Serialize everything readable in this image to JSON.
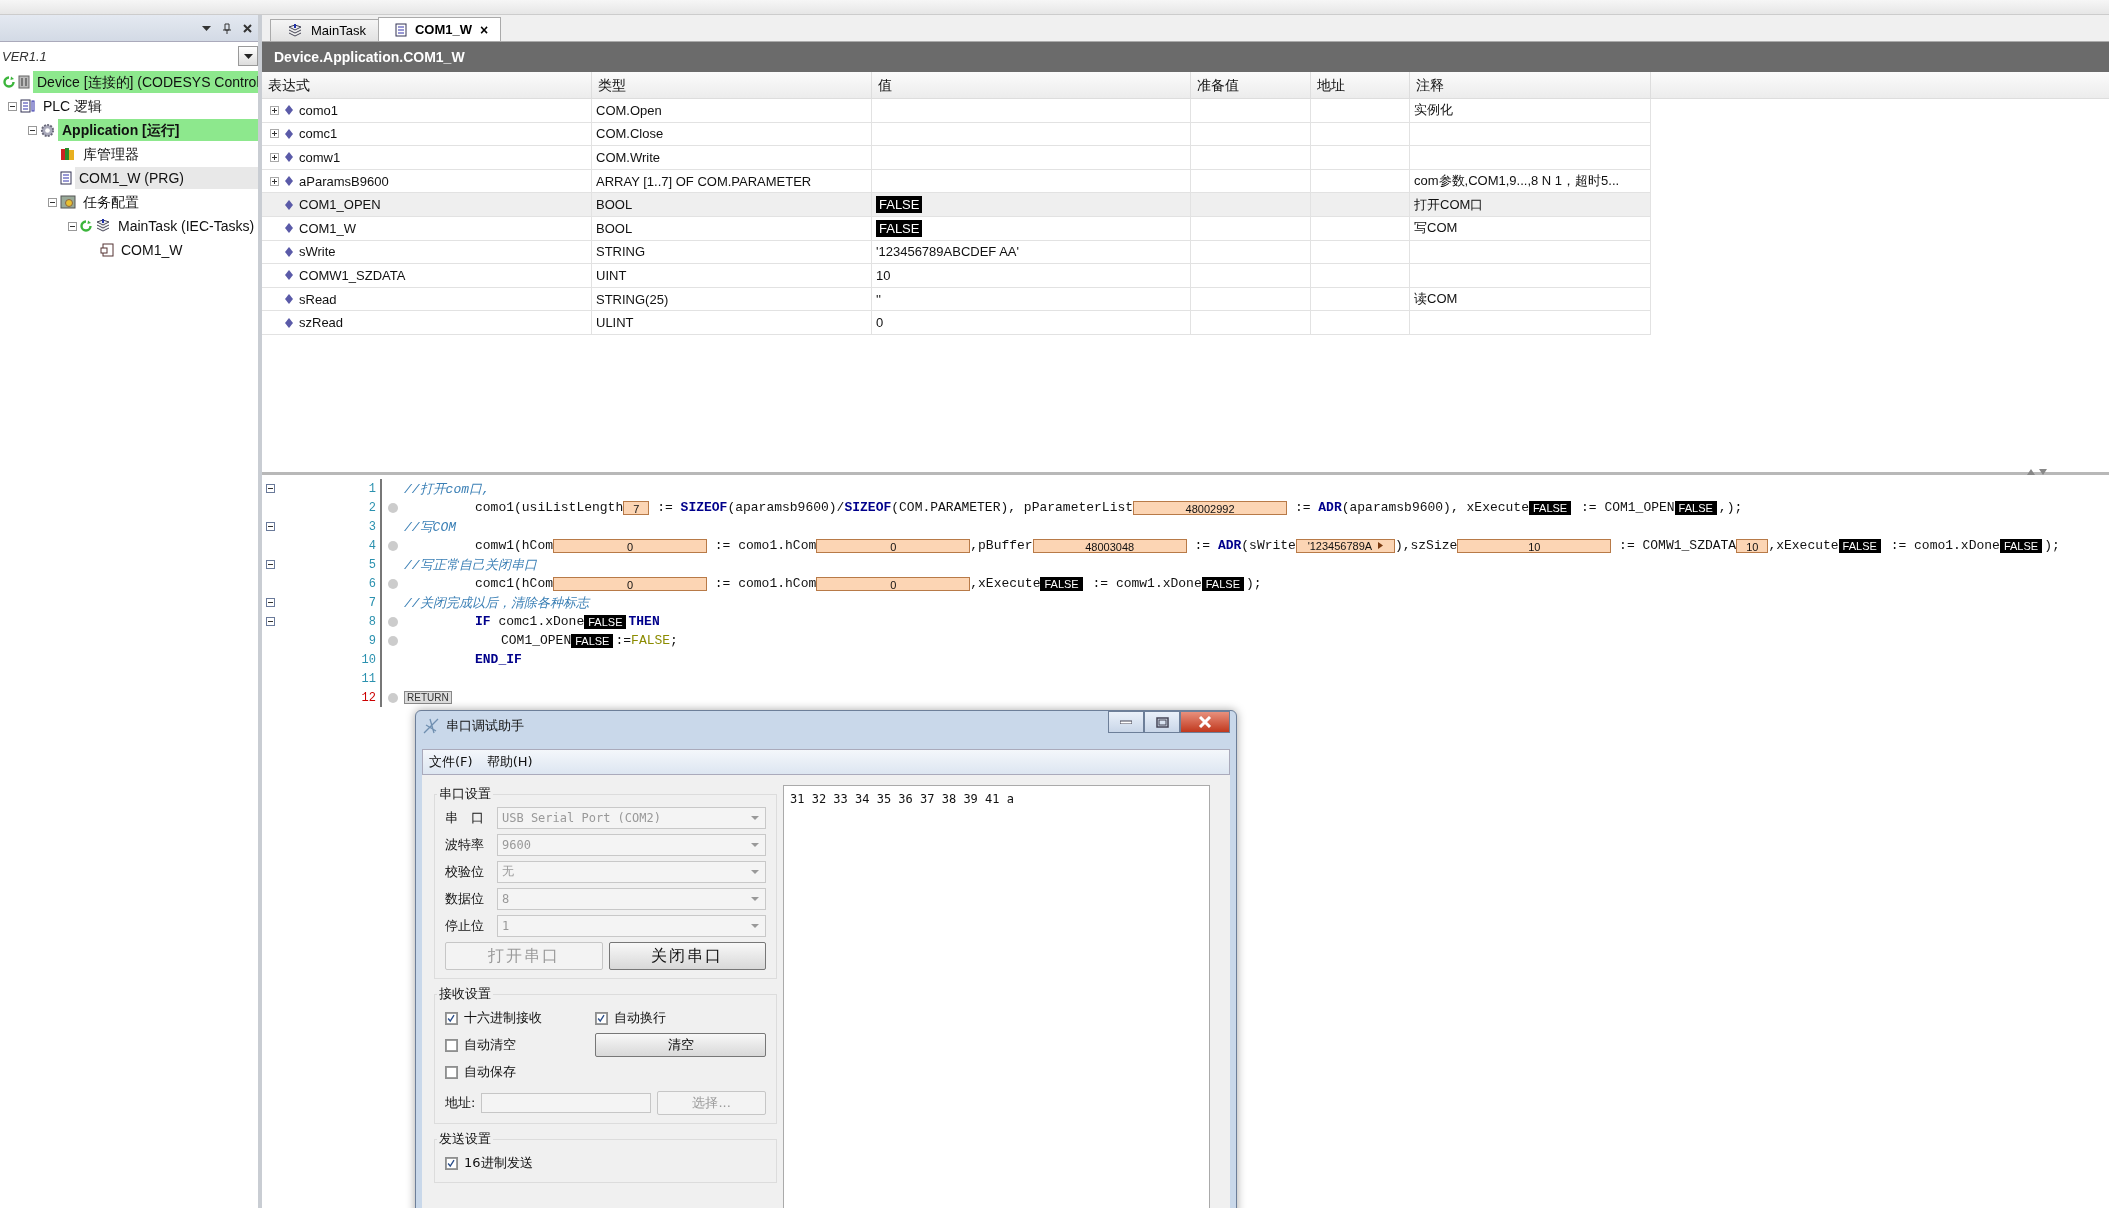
{
  "left_panel": {
    "version": "VER1.1",
    "tree": [
      {
        "label": "Device [连接的] (CODESYS Control",
        "kind": "device",
        "running": true,
        "highlighted": true,
        "selected": false,
        "active": false,
        "children": [
          {
            "label": "PLC 逻辑",
            "kind": "plc",
            "running": false,
            "highlighted": false,
            "selected": false,
            "active": false,
            "children": [
              {
                "label": "Application [运行]",
                "kind": "application",
                "running": false,
                "highlighted": true,
                "selected": false,
                "active": true,
                "children": [
                  {
                    "label": "库管理器",
                    "kind": "library",
                    "running": false,
                    "highlighted": false,
                    "selected": false,
                    "active": false
                  },
                  {
                    "label": "COM1_W (PRG)",
                    "kind": "pou",
                    "running": false,
                    "highlighted": false,
                    "selected": true,
                    "active": false
                  },
                  {
                    "label": "任务配置",
                    "kind": "taskconfig",
                    "running": false,
                    "highlighted": false,
                    "selected": false,
                    "active": false,
                    "children": [
                      {
                        "label": "MainTask (IEC-Tasks)",
                        "kind": "task",
                        "running": true,
                        "highlighted": false,
                        "selected": false,
                        "active": false,
                        "children": [
                          {
                            "label": "COM1_W",
                            "kind": "program",
                            "running": false,
                            "highlighted": false,
                            "selected": false,
                            "active": false
                          }
                        ]
                      }
                    ]
                  }
                ]
              }
            ]
          }
        ]
      }
    ]
  },
  "tabs": [
    {
      "label": "MainTask",
      "kind": "task",
      "selected": false
    },
    {
      "label": "COM1_W",
      "kind": "pou",
      "selected": true,
      "close": "×"
    }
  ],
  "editor_title": "Device.Application.COM1_W",
  "table": {
    "columns": [
      "表达式",
      "类型",
      "值",
      "准备值",
      "地址",
      "注释"
    ],
    "rows": [
      {
        "expression": "como1",
        "type": "COM.Open",
        "expandable": true,
        "selected": false,
        "kind": "plain",
        "comment": "实例化"
      },
      {
        "expression": "comc1",
        "type": "COM.Close",
        "expandable": true,
        "selected": false,
        "kind": "plain"
      },
      {
        "expression": "comw1",
        "type": "COM.Write",
        "expandable": true,
        "selected": false,
        "kind": "plain"
      },
      {
        "expression": "aParamsB9600",
        "type": "ARRAY [1..7] OF COM.PARAMETER",
        "expandable": true,
        "selected": false,
        "kind": "plain",
        "comment": "com参数,COM1,9...,8 N 1，超时5..."
      },
      {
        "expression": "COM1_OPEN",
        "type": "BOOL",
        "value": "FALSE",
        "expandable": false,
        "selected": true,
        "kind": "bool",
        "comment": "打开COM口"
      },
      {
        "expression": "COM1_W",
        "type": "BOOL",
        "value": "FALSE",
        "expandable": false,
        "selected": false,
        "kind": "bool",
        "comment": "写COM"
      },
      {
        "expression": "sWrite",
        "type": "STRING",
        "value": "'123456789ABCDEF AA'",
        "expandable": false,
        "selected": false,
        "kind": "plain"
      },
      {
        "expression": "COMW1_SZDATA",
        "type": "UINT",
        "value": "10",
        "expandable": false,
        "selected": false,
        "kind": "plain"
      },
      {
        "expression": "sRead",
        "type": "STRING(25)",
        "value": "''",
        "expandable": false,
        "selected": false,
        "kind": "plain",
        "comment": "读COM"
      },
      {
        "expression": "szRead",
        "type": "ULINT",
        "value": "0",
        "expandable": false,
        "selected": false,
        "kind": "plain"
      }
    ]
  },
  "code": [
    {
      "number": "1",
      "kind": "comment",
      "fold": true,
      "breakpoint": false,
      "current": false,
      "segments": [
        {
          "kind": "comment",
          "text": "//打开com口,"
        }
      ]
    },
    {
      "number": "2",
      "kind": "code",
      "fold": false,
      "breakpoint": true,
      "current": false,
      "segments": [
        {
          "kind": "text",
          "text": "como1(usiListLength"
        },
        {
          "kind": "value_small",
          "text": "7"
        },
        {
          "kind": "text",
          "text": " := "
        },
        {
          "kind": "keyword",
          "text": "SIZEOF"
        },
        {
          "kind": "text",
          "text": "(aparamsb9600)/"
        },
        {
          "kind": "keyword",
          "text": "SIZEOF"
        },
        {
          "kind": "text",
          "text": "(COM.PARAMETER), pParameterList"
        },
        {
          "kind": "value",
          "text": "48002992"
        },
        {
          "kind": "text",
          "text": " := "
        },
        {
          "kind": "keyword",
          "text": "ADR"
        },
        {
          "kind": "text",
          "text": "(aparamsb9600), xExecute"
        },
        {
          "kind": "bool",
          "text": "FALSE"
        },
        {
          "kind": "text",
          "text": " := COM1_OPEN"
        },
        {
          "kind": "bool",
          "text": "FALSE"
        },
        {
          "kind": "text",
          "text": ",);"
        }
      ]
    },
    {
      "number": "3",
      "kind": "comment",
      "fold": true,
      "breakpoint": false,
      "current": false,
      "segments": [
        {
          "kind": "comment",
          "text": "//写COM"
        }
      ]
    },
    {
      "number": "4",
      "kind": "code",
      "fold": false,
      "breakpoint": true,
      "current": false,
      "segments": [
        {
          "kind": "text",
          "text": "comw1(hCom"
        },
        {
          "kind": "value",
          "text": "0"
        },
        {
          "kind": "text",
          "text": " := como1.hCom"
        },
        {
          "kind": "value",
          "text": "0"
        },
        {
          "kind": "text",
          "text": ",pBuffer"
        },
        {
          "kind": "value",
          "text": "48003048"
        },
        {
          "kind": "text",
          "text": " := "
        },
        {
          "kind": "keyword",
          "text": "ADR"
        },
        {
          "kind": "text",
          "text": "(sWrite"
        },
        {
          "kind": "value_string",
          "text": "'123456789A"
        },
        {
          "kind": "text",
          "text": "),szSize"
        },
        {
          "kind": "value",
          "text": "10"
        },
        {
          "kind": "text",
          "text": " := COMW1_SZDATA"
        },
        {
          "kind": "value_small",
          "text": "10"
        },
        {
          "kind": "text",
          "text": ",xExecute"
        },
        {
          "kind": "bool",
          "text": "FALSE"
        },
        {
          "kind": "text",
          "text": " := como1.xDone"
        },
        {
          "kind": "bool",
          "text": "FALSE"
        },
        {
          "kind": "text",
          "text": ");"
        }
      ]
    },
    {
      "number": "5",
      "kind": "comment",
      "fold": true,
      "breakpoint": false,
      "current": false,
      "segments": [
        {
          "kind": "comment",
          "text": "//写正常自己关闭串口"
        }
      ]
    },
    {
      "number": "6",
      "kind": "code",
      "fold": false,
      "breakpoint": true,
      "current": false,
      "segments": [
        {
          "kind": "text",
          "text": "comc1(hCom"
        },
        {
          "kind": "value",
          "text": "0"
        },
        {
          "kind": "text",
          "text": " := como1.hCom"
        },
        {
          "kind": "value",
          "text": "0"
        },
        {
          "kind": "text",
          "text": ",xExecute"
        },
        {
          "kind": "bool",
          "text": "FALSE"
        },
        {
          "kind": "text",
          "text": " := comw1.xDone"
        },
        {
          "kind": "bool",
          "text": "FALSE"
        },
        {
          "kind": "text",
          "text": ");"
        }
      ]
    },
    {
      "number": "7",
      "kind": "comment",
      "fold": true,
      "breakpoint": false,
      "current": false,
      "segments": [
        {
          "kind": "comment",
          "text": "//关闭完成以后，清除各种标志"
        }
      ]
    },
    {
      "number": "8",
      "kind": "code",
      "fold": true,
      "breakpoint": true,
      "current": false,
      "segments": [
        {
          "kind": "keyword",
          "text": "IF"
        },
        {
          "kind": "text",
          "text": " comc1.xDone"
        },
        {
          "kind": "bool",
          "text": "FALSE"
        },
        {
          "kind": "keyword",
          "text": "THEN"
        }
      ]
    },
    {
      "number": "9",
      "kind": "inner",
      "fold": false,
      "breakpoint": true,
      "current": false,
      "segments": [
        {
          "kind": "text",
          "text": "COM1_OPEN"
        },
        {
          "kind": "bool",
          "text": "FALSE"
        },
        {
          "kind": "text",
          "text": ":="
        },
        {
          "kind": "literal",
          "text": "FALSE"
        },
        {
          "kind": "text",
          "text": ";"
        }
      ]
    },
    {
      "number": "10",
      "kind": "code",
      "fold": false,
      "breakpoint": false,
      "current": false,
      "segments": [
        {
          "kind": "keyword",
          "text": "END_IF"
        }
      ]
    },
    {
      "number": "11",
      "kind": "blank",
      "fold": false,
      "breakpoint": false,
      "current": false
    },
    {
      "number": "12",
      "kind": "comment",
      "fold": false,
      "breakpoint": true,
      "current": true,
      "segments": [
        {
          "kind": "return",
          "text": "RETURN"
        }
      ]
    }
  ],
  "dialog": {
    "title": "串口调试助手",
    "menu": [
      "文件(F)",
      "帮助(H)"
    ],
    "serial": {
      "legend": "串口设置",
      "fields": [
        {
          "label": "串　口",
          "value": "USB Serial Port (COM2)",
          "disabled": true
        },
        {
          "label": "波特率",
          "value": "9600",
          "disabled": true
        },
        {
          "label": "校验位",
          "value": "无",
          "disabled": true
        },
        {
          "label": "数据位",
          "value": "8",
          "disabled": true
        },
        {
          "label": "停止位",
          "value": "1",
          "disabled": true
        }
      ],
      "buttons": [
        {
          "label": "打开串口",
          "disabled": true
        },
        {
          "label": "关闭串口",
          "disabled": false
        }
      ]
    },
    "receive": {
      "legend": "接收设置",
      "checkboxes": [
        {
          "label": "十六进制接收",
          "checked": true
        },
        {
          "label": "自动清空",
          "checked": false
        },
        {
          "label": "自动保存",
          "checked": false
        }
      ],
      "wrap": {
        "label": "自动换行",
        "checked": true
      },
      "clear_button": {
        "label": "清空",
        "disabled": false
      },
      "address_label": "地址:",
      "browse_button": {
        "label": "选择...",
        "disabled": true
      }
    },
    "send": {
      "legend": "发送设置",
      "checkboxes": [
        {
          "label": "16进制发送",
          "checked": true
        }
      ]
    },
    "received_text": "31 32 33 34 35 36 37 38 39 41 a"
  }
}
